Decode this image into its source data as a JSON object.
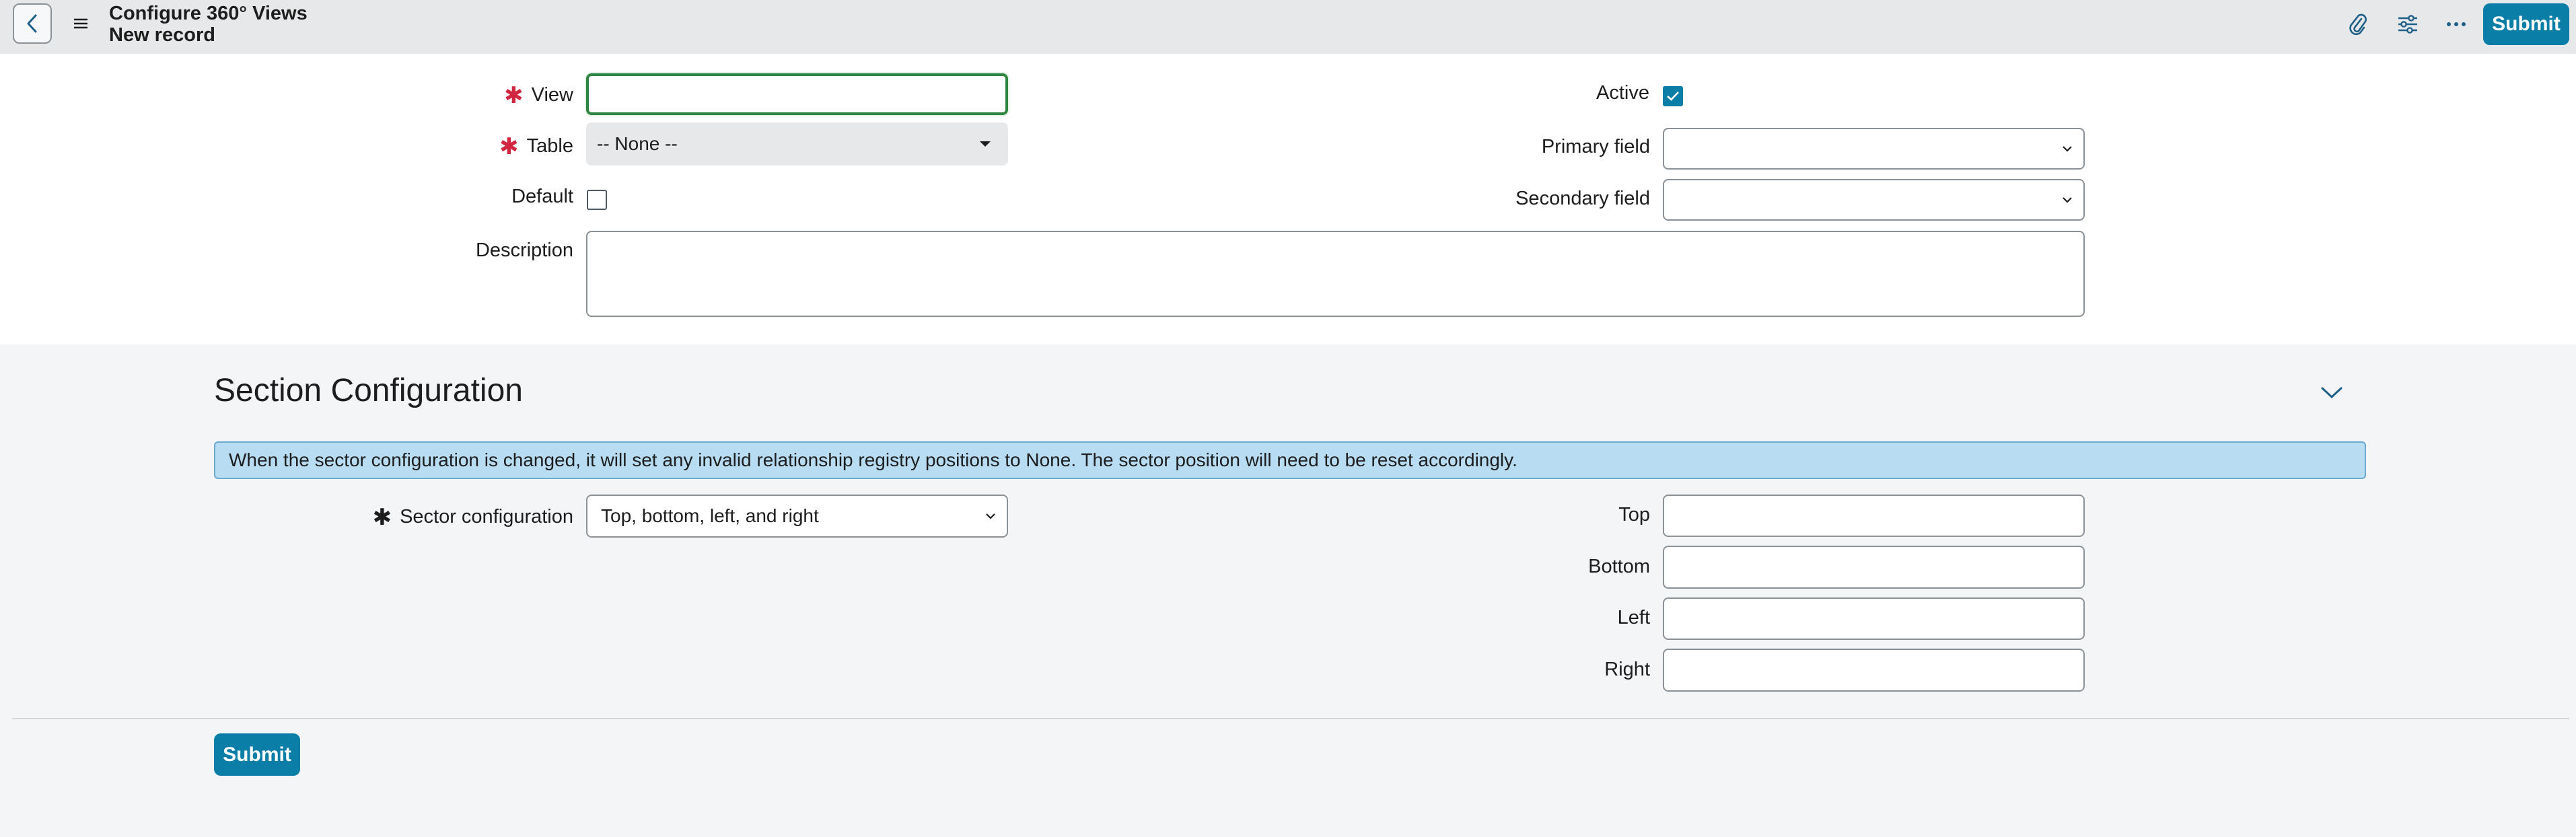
{
  "header": {
    "title": "Configure 360° Views",
    "subtitle": "New record",
    "submit_label": "Submit"
  },
  "form": {
    "view_label": "View",
    "view_value": "",
    "table_label": "Table",
    "table_value": "-- None --",
    "default_label": "Default",
    "default_checked": false,
    "description_label": "Description",
    "description_value": "",
    "active_label": "Active",
    "active_checked": true,
    "primary_field_label": "Primary field",
    "primary_field_value": "",
    "secondary_field_label": "Secondary field",
    "secondary_field_value": ""
  },
  "section": {
    "title": "Section Configuration",
    "info_message": "When the sector configuration is changed, it will set any invalid relationship registry positions to None. The sector position will need to be reset accordingly.",
    "sector_config_label": "Sector configuration",
    "sector_config_value": "Top, bottom, left, and right",
    "top_label": "Top",
    "bottom_label": "Bottom",
    "left_label": "Left",
    "right_label": "Right",
    "top_value": "",
    "bottom_value": "",
    "left_value": "",
    "right_value": ""
  },
  "footer": {
    "submit_label": "Submit"
  },
  "colors": {
    "accent": "#0b7ea7",
    "required": "#d0263f",
    "focus": "#2e8540",
    "info_bg": "#b8dcf2"
  }
}
